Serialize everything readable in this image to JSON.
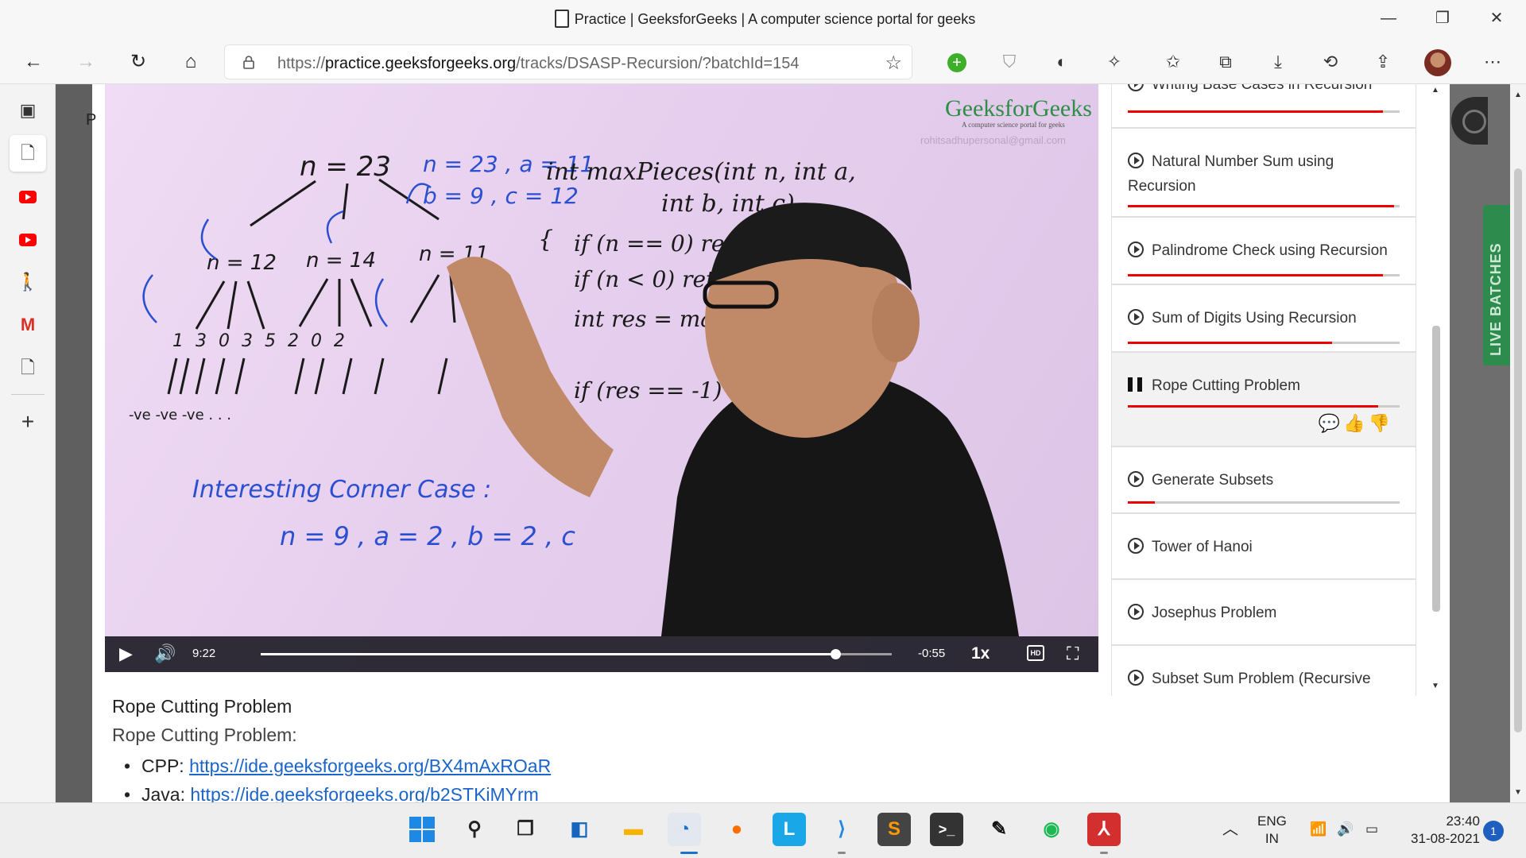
{
  "window": {
    "title": "Practice | GeeksforGeeks | A computer science portal for geeks"
  },
  "browser": {
    "url_prefix": "https://",
    "url_host": "practice.geeksforgeeks.org",
    "url_path": "/tracks/DSASP-Recursion/?batchId=154"
  },
  "video": {
    "brand": "GeeksforGeeks",
    "brand_tagline": "A computer science portal for geeks",
    "watermark_email": "rohitsadhupersonal@gmail.com",
    "current_time": "9:22",
    "remaining_time": "-0:55",
    "speed": "1x",
    "hd_label": "HD",
    "progress_fraction": 0.91,
    "whiteboard": {
      "root": "n = 23",
      "params_line1": "n = 23 , a = 11",
      "params_line2": "b = 9 , c = 12",
      "node_left": "n = 12",
      "node_mid": "n = 14",
      "node_right": "n = 11",
      "level3": "1   3   0   3   5   2   0   2",
      "neg": "-ve -ve -ve . . .",
      "corner_title": "Interesting Corner Case :",
      "corner_values": "n = 9 , a = 2 , b = 2 , c",
      "code_sig1": "int maxPieces(int n, int a,",
      "code_sig2": "int b, int c)",
      "code_l1": "if (n == 0) return",
      "code_l2": "if (n < 0) return",
      "code_l3": "int res = max",
      "code_l4": "if (res == -1)"
    }
  },
  "playlist": {
    "items": [
      {
        "title": "Writing Base Cases in Recursion",
        "progress": 0.94
      },
      {
        "title": "Natural Number Sum using Recursion",
        "progress": 0.98
      },
      {
        "title": "Palindrome Check using Recursion",
        "progress": 0.94
      },
      {
        "title": "Sum of Digits Using Recursion",
        "progress": 0.75
      },
      {
        "title": "Rope Cutting Problem",
        "progress": 0.92
      },
      {
        "title": "Generate Subsets",
        "progress": 0.1
      },
      {
        "title": "Tower of Hanoi",
        "progress": 0
      },
      {
        "title": "Josephus Problem",
        "progress": 0
      },
      {
        "title": "Subset Sum Problem (Recursive Solution)",
        "progress": 0
      }
    ]
  },
  "description": {
    "title": "Rope Cutting Problem",
    "subtitle": "Rope Cutting Problem:",
    "links": [
      {
        "lang": "CPP:",
        "url": "https://ide.geeksforgeeks.org/BX4mAxROaR"
      },
      {
        "lang": "Java:",
        "url": "https://ide.geeksforgeeks.org/b2STKiMYrm"
      }
    ]
  },
  "side_panel": {
    "live_label": "LIVE BATCHES"
  },
  "taskbar": {
    "lang_line1": "ENG",
    "lang_line2": "IN",
    "time": "23:40",
    "date": "31-08-2021",
    "notification_count": "1"
  }
}
